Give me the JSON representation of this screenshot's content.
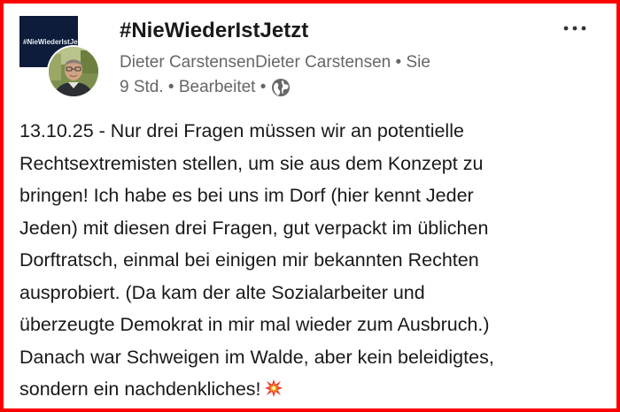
{
  "post": {
    "group_logo_text": "#NieWiederIstJetzt",
    "title": "#NieWiederIstJetzt",
    "author_line": "Dieter CarstensenDieter Carstensen • Sie",
    "meta_line": "9 Std. • Bearbeitet •",
    "body_lines": [
      "13.10.25 - Nur drei Fragen müssen wir an potentielle",
      "Rechtsextremisten stellen, um sie aus dem Konzept zu",
      "bringen! Ich habe es bei uns im Dorf (hier kennt Jeder",
      "Jeden) mit diesen drei Fragen, gut verpackt im üblichen",
      "Dorftratsch, einmal bei einigen mir bekannten Rechten",
      "ausprobiert. (Da kam der alte Sozialarbeiter und",
      "überzeugte Demokrat in mir mal wieder zum Ausbruch.)",
      "Danach war Schweigen im Walde, aber kein beleidigtes,",
      "sondern ein nachdenkliches!"
    ]
  },
  "icons": {
    "more": "more-options-icon",
    "visibility": "globe-icon",
    "emoji": "collision-burst-icon"
  },
  "colors": {
    "frame_border": "#ff0000",
    "text_primary": "#191919",
    "text_secondary": "#666666",
    "logo_background": "#0c1c3a"
  }
}
